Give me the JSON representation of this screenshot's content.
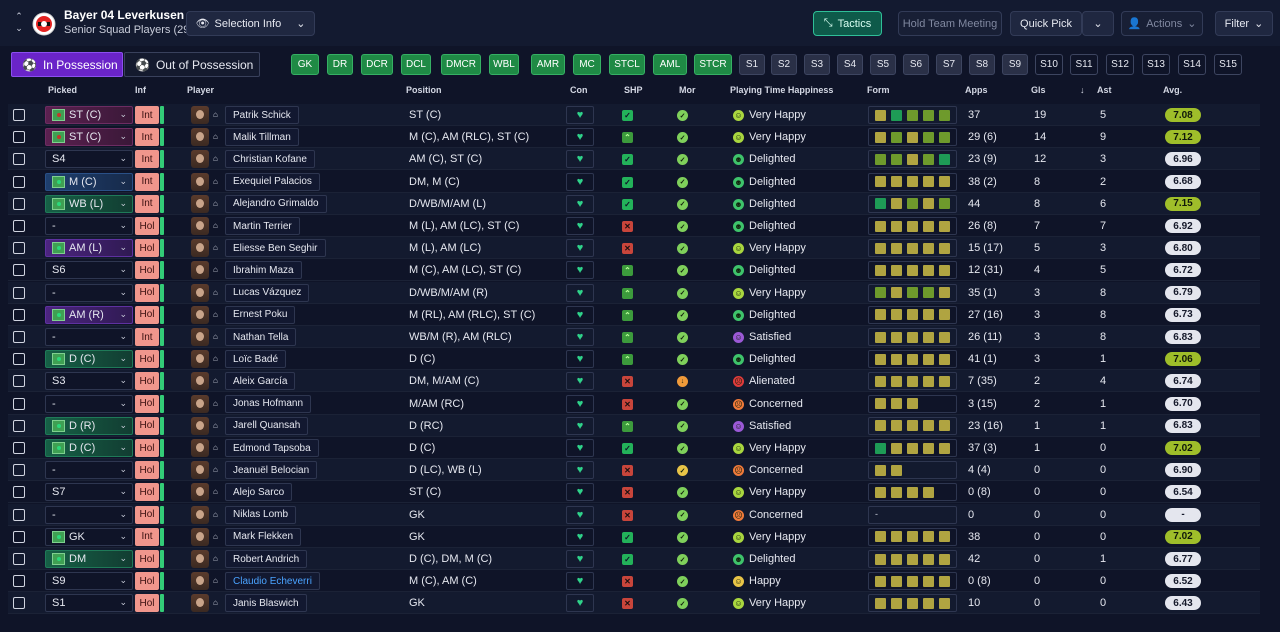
{
  "club": {
    "name": "Bayer 04 Leverkusen",
    "subtitle": "Senior Squad Players (29)"
  },
  "toolbar": {
    "selection_info": "Selection Info",
    "tactics": "Tactics",
    "hold_team_meeting": "Hold Team Meeting",
    "quick_pick": "Quick Pick",
    "actions": "Actions",
    "filter": "Filter"
  },
  "possession": {
    "in": "In Possession",
    "out": "Out of Possession"
  },
  "positions": [
    "GK",
    "DR",
    "DCR",
    "DCL",
    "DMCR",
    "WBL",
    "AMR",
    "MC",
    "STCL",
    "AML",
    "STCR"
  ],
  "slots": [
    "S1",
    "S2",
    "S3",
    "S4",
    "S5",
    "S6",
    "S7",
    "S8",
    "S9",
    "S10",
    "S11",
    "S12",
    "S13",
    "S14",
    "S15"
  ],
  "headers": {
    "picked": "Picked",
    "inf": "Inf",
    "player": "Player",
    "position": "Position",
    "con": "Con",
    "shp": "SHP",
    "mor": "Mor",
    "happiness": "Playing Time Happiness",
    "form": "Form",
    "apps": "Apps",
    "gls": "Gls",
    "ast": "Ast",
    "avg": "Avg."
  },
  "colors": {
    "accent_purple": "#6a24c8",
    "teal": "#2fbf98",
    "green_pill": "#1f8a45",
    "rating_high": "#9fbe2a"
  },
  "players": [
    {
      "picked": "ST (C)",
      "pcol": "magenta",
      "pico": true,
      "inf": "Int",
      "name": "Patrik Schick",
      "position": "ST (C)",
      "shp": "tick",
      "mor": "g",
      "happiness": "Very Happy",
      "hcls": "vh",
      "form": [
        "y",
        "g",
        "l",
        "l",
        "l"
      ],
      "apps": "37",
      "gls": "19",
      "ast": "5",
      "avg": "7.08",
      "avgHi": true
    },
    {
      "picked": "ST (C)",
      "pcol": "magenta",
      "pico": true,
      "inf": "Int",
      "name": "Malik Tillman",
      "position": "M (C), AM (RLC), ST (C)",
      "shp": "up",
      "mor": "g",
      "happiness": "Very Happy",
      "hcls": "vh",
      "form": [
        "y",
        "l",
        "y",
        "l",
        "l"
      ],
      "apps": "29 (6)",
      "gls": "14",
      "ast": "9",
      "avg": "7.12",
      "avgHi": true
    },
    {
      "picked": "S4",
      "pcol": "",
      "pico": false,
      "inf": "Int",
      "name": "Christian Kofane",
      "position": "AM (C), ST (C)",
      "shp": "tick",
      "mor": "g",
      "happiness": "Delighted",
      "hcls": "d",
      "form": [
        "l",
        "l",
        "y",
        "l",
        "g"
      ],
      "apps": "23 (9)",
      "gls": "12",
      "ast": "3",
      "avg": "6.96",
      "avgHi": false
    },
    {
      "picked": "M (C)",
      "pcol": "blue",
      "pico": true,
      "inf": "Int",
      "name": "Exequiel Palacios",
      "position": "DM, M (C)",
      "shp": "tick",
      "mor": "g",
      "happiness": "Delighted",
      "hcls": "d",
      "form": [
        "y",
        "y",
        "y",
        "y",
        "y"
      ],
      "apps": "38 (2)",
      "gls": "8",
      "ast": "2",
      "avg": "6.68",
      "avgHi": false
    },
    {
      "picked": "WB (L)",
      "pcol": "green",
      "pico": true,
      "inf": "Int",
      "name": "Alejandro Grimaldo",
      "position": "D/WB/M/AM (L)",
      "shp": "tick",
      "mor": "g",
      "happiness": "Delighted",
      "hcls": "d",
      "form": [
        "g",
        "y",
        "l",
        "y",
        "l"
      ],
      "apps": "44",
      "gls": "8",
      "ast": "6",
      "avg": "7.15",
      "avgHi": true
    },
    {
      "picked": "-",
      "pcol": "",
      "pico": false,
      "inf": "Hol",
      "name": "Martin Terrier",
      "position": "M (L), AM (LC), ST (C)",
      "shp": "cross",
      "mor": "g",
      "happiness": "Delighted",
      "hcls": "d",
      "form": [
        "y",
        "y",
        "y",
        "y",
        "y"
      ],
      "apps": "26 (8)",
      "gls": "7",
      "ast": "7",
      "avg": "6.92",
      "avgHi": false
    },
    {
      "picked": "AM (L)",
      "pcol": "purple",
      "pico": true,
      "inf": "Hol",
      "name": "Eliesse Ben Seghir",
      "position": "M (L), AM (LC)",
      "shp": "cross",
      "mor": "g",
      "happiness": "Very Happy",
      "hcls": "vh",
      "form": [
        "y",
        "y",
        "y",
        "y",
        "y"
      ],
      "apps": "15 (17)",
      "gls": "5",
      "ast": "3",
      "avg": "6.80",
      "avgHi": false
    },
    {
      "picked": "S6",
      "pcol": "",
      "pico": false,
      "inf": "Hol",
      "name": "Ibrahim Maza",
      "position": "M (C), AM (LC), ST (C)",
      "shp": "up",
      "mor": "g",
      "happiness": "Delighted",
      "hcls": "d",
      "form": [
        "y",
        "y",
        "y",
        "y",
        "y"
      ],
      "apps": "12 (31)",
      "gls": "4",
      "ast": "5",
      "avg": "6.72",
      "avgHi": false
    },
    {
      "picked": "-",
      "pcol": "",
      "pico": false,
      "inf": "Hol",
      "name": "Lucas Vázquez",
      "position": "D/WB/M/AM (R)",
      "shp": "up",
      "mor": "g",
      "happiness": "Very Happy",
      "hcls": "vh",
      "form": [
        "l",
        "y",
        "l",
        "l",
        "y"
      ],
      "apps": "35 (1)",
      "gls": "3",
      "ast": "8",
      "avg": "6.79",
      "avgHi": false
    },
    {
      "picked": "AM (R)",
      "pcol": "purple",
      "pico": true,
      "inf": "Hol",
      "name": "Ernest Poku",
      "position": "M (RL), AM (RLC), ST (C)",
      "shp": "up",
      "mor": "g",
      "happiness": "Delighted",
      "hcls": "d",
      "form": [
        "y",
        "y",
        "y",
        "y",
        "y"
      ],
      "apps": "27 (16)",
      "gls": "3",
      "ast": "8",
      "avg": "6.73",
      "avgHi": false
    },
    {
      "picked": "-",
      "pcol": "",
      "pico": false,
      "inf": "Int",
      "name": "Nathan Tella",
      "position": "WB/M (R), AM (RLC)",
      "shp": "up",
      "mor": "g",
      "happiness": "Satisfied",
      "hcls": "s",
      "form": [
        "y",
        "y",
        "y",
        "y",
        "y"
      ],
      "apps": "26 (11)",
      "gls": "3",
      "ast": "8",
      "avg": "6.83",
      "avgHi": false
    },
    {
      "picked": "D (C)",
      "pcol": "green",
      "pico": true,
      "inf": "Hol",
      "name": "Loïc Badé",
      "position": "D (C)",
      "shp": "up",
      "mor": "g",
      "happiness": "Delighted",
      "hcls": "d",
      "form": [
        "y",
        "y",
        "y",
        "y",
        "y"
      ],
      "apps": "41 (1)",
      "gls": "3",
      "ast": "1",
      "avg": "7.06",
      "avgHi": true
    },
    {
      "picked": "S3",
      "pcol": "",
      "pico": false,
      "inf": "Hol",
      "name": "Aleix García",
      "position": "DM, M/AM (C)",
      "shp": "cross",
      "mor": "o",
      "happiness": "Alienated",
      "hcls": "a",
      "form": [
        "y",
        "y",
        "y",
        "y",
        "y"
      ],
      "apps": "7 (35)",
      "gls": "2",
      "ast": "4",
      "avg": "6.74",
      "avgHi": false
    },
    {
      "picked": "-",
      "pcol": "",
      "pico": false,
      "inf": "Hol",
      "name": "Jonas Hofmann",
      "position": "M/AM (RC)",
      "shp": "cross",
      "mor": "g",
      "happiness": "Concerned",
      "hcls": "c",
      "form": [
        "y",
        "y",
        "y"
      ],
      "apps": "3 (15)",
      "gls": "2",
      "ast": "1",
      "avg": "6.70",
      "avgHi": false
    },
    {
      "picked": "D (R)",
      "pcol": "green",
      "pico": true,
      "inf": "Hol",
      "name": "Jarell Quansah",
      "position": "D (RC)",
      "shp": "up",
      "mor": "g",
      "happiness": "Satisfied",
      "hcls": "s",
      "form": [
        "y",
        "y",
        "y",
        "y",
        "y"
      ],
      "apps": "23 (16)",
      "gls": "1",
      "ast": "1",
      "avg": "6.83",
      "avgHi": false
    },
    {
      "picked": "D (C)",
      "pcol": "green",
      "pico": true,
      "inf": "Hol",
      "name": "Edmond Tapsoba",
      "position": "D (C)",
      "shp": "tick",
      "mor": "g",
      "happiness": "Very Happy",
      "hcls": "vh",
      "form": [
        "g",
        "y",
        "y",
        "y",
        "y"
      ],
      "apps": "37 (3)",
      "gls": "1",
      "ast": "0",
      "avg": "7.02",
      "avgHi": true
    },
    {
      "picked": "-",
      "pcol": "",
      "pico": false,
      "inf": "Hol",
      "name": "Jeanuël Belocian",
      "position": "D (LC), WB (L)",
      "shp": "cross",
      "mor": "y",
      "happiness": "Concerned",
      "hcls": "c",
      "form": [
        "y",
        "y"
      ],
      "apps": "4 (4)",
      "gls": "0",
      "ast": "0",
      "avg": "6.90",
      "avgHi": false
    },
    {
      "picked": "S7",
      "pcol": "",
      "pico": false,
      "inf": "Hol",
      "name": "Alejo Sarco",
      "position": "ST (C)",
      "shp": "cross",
      "mor": "g",
      "happiness": "Very Happy",
      "hcls": "vh",
      "form": [
        "y",
        "y",
        "y",
        "y"
      ],
      "apps": "0 (8)",
      "gls": "0",
      "ast": "0",
      "avg": "6.54",
      "avgHi": false
    },
    {
      "picked": "-",
      "pcol": "",
      "pico": false,
      "inf": "Hol",
      "name": "Niklas Lomb",
      "position": "GK",
      "shp": "cross",
      "mor": "g",
      "happiness": "Concerned",
      "hcls": "c",
      "form": [],
      "apps": "0",
      "gls": "0",
      "ast": "0",
      "avg": "-",
      "avgHi": false
    },
    {
      "picked": "GK",
      "pcol": "",
      "pico": true,
      "inf": "Int",
      "name": "Mark Flekken",
      "position": "GK",
      "shp": "tick",
      "mor": "g",
      "happiness": "Very Happy",
      "hcls": "vh",
      "form": [
        "y",
        "y",
        "y",
        "y",
        "y"
      ],
      "apps": "38",
      "gls": "0",
      "ast": "0",
      "avg": "7.02",
      "avgHi": true
    },
    {
      "picked": "DM",
      "pcol": "green",
      "pico": true,
      "inf": "Hol",
      "name": "Robert Andrich",
      "position": "D (C), DM, M (C)",
      "shp": "tick",
      "mor": "g",
      "happiness": "Delighted",
      "hcls": "d",
      "form": [
        "y",
        "y",
        "y",
        "y",
        "y"
      ],
      "apps": "42",
      "gls": "0",
      "ast": "1",
      "avg": "6.77",
      "avgHi": false
    },
    {
      "picked": "S9",
      "pcol": "",
      "pico": false,
      "inf": "Hol",
      "name": "Claudio Echeverri",
      "position": "M (C), AM (C)",
      "shp": "cross",
      "mor": "g",
      "happiness": "Happy",
      "hcls": "h",
      "form": [
        "y",
        "y",
        "y",
        "y",
        "y"
      ],
      "apps": "0 (8)",
      "gls": "0",
      "ast": "0",
      "avg": "6.52",
      "avgHi": false,
      "link": true
    },
    {
      "picked": "S1",
      "pcol": "",
      "pico": false,
      "inf": "Hol",
      "name": "Janis Blaswich",
      "position": "GK",
      "shp": "cross",
      "mor": "g",
      "happiness": "Very Happy",
      "hcls": "vh",
      "form": [
        "y",
        "y",
        "y",
        "y",
        "y"
      ],
      "apps": "10",
      "gls": "0",
      "ast": "0",
      "avg": "6.43",
      "avgHi": false
    }
  ]
}
